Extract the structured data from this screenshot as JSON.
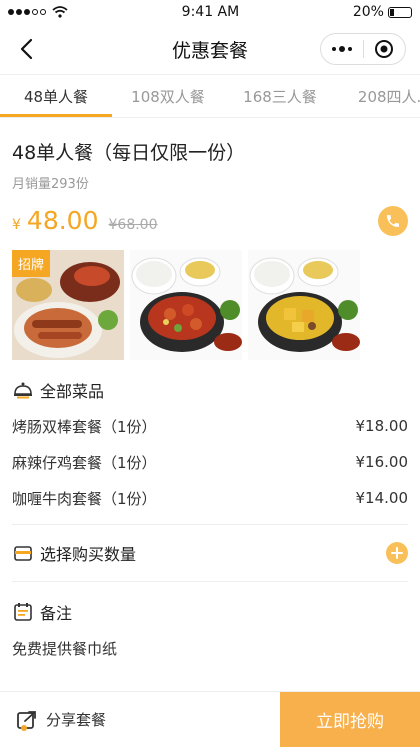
{
  "status": {
    "carrier_dots": 5,
    "time": "9:41 AM",
    "battery": "20%"
  },
  "nav": {
    "title": "优惠套餐"
  },
  "tabs": [
    {
      "label": "48单人餐",
      "active": true
    },
    {
      "label": "108双人餐",
      "active": false
    },
    {
      "label": "168三人餐",
      "active": false
    },
    {
      "label": "208四人..",
      "active": false
    }
  ],
  "product": {
    "title": "48单人餐（每日仅限一份）",
    "monthly_sales": "月销量293份",
    "currency": "¥",
    "price": "48.00",
    "old_price": "¥68.00",
    "badge": "招牌"
  },
  "dishes_section": {
    "title": "全部菜品",
    "items": [
      {
        "name": "烤肠双棒套餐（1份）",
        "price": "¥18.00"
      },
      {
        "name": "麻辣仔鸡套餐（1份）",
        "price": "¥16.00"
      },
      {
        "name": "咖喱牛肉套餐（1份）",
        "price": "¥14.00"
      }
    ]
  },
  "quantity": {
    "title": "选择购买数量"
  },
  "remark": {
    "title": "备注",
    "text": "免费提供餐巾纸"
  },
  "bottom": {
    "share": "分享套餐",
    "buy": "立即抢购"
  },
  "colors": {
    "accent": "#f5a623",
    "accent_light": "#f9c05a",
    "buy_bg": "#f7b04b"
  }
}
